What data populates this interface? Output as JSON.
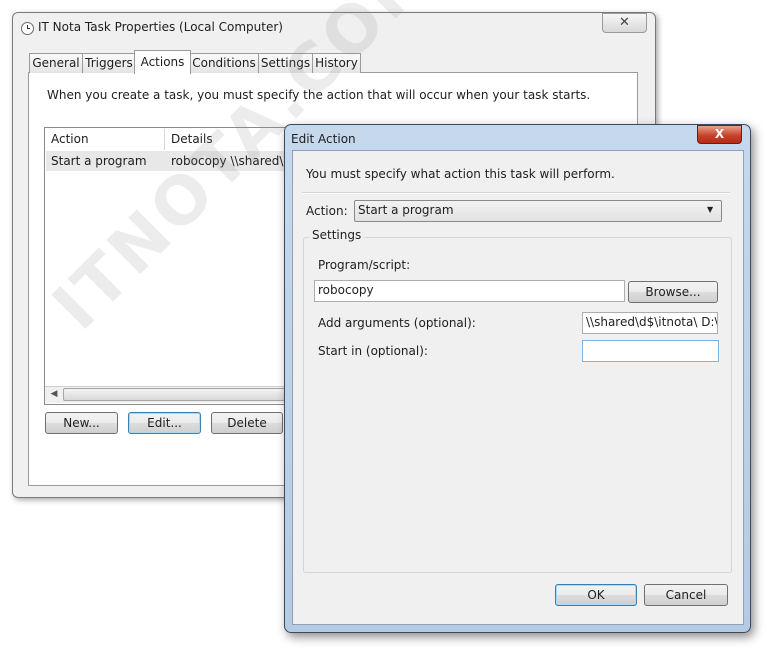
{
  "properties_window": {
    "title": "IT Nota Task Properties (Local Computer)",
    "close_glyph": "✕",
    "tabs": [
      {
        "label": "General"
      },
      {
        "label": "Triggers"
      },
      {
        "label": "Actions",
        "active": true
      },
      {
        "label": "Conditions"
      },
      {
        "label": "Settings"
      },
      {
        "label": "History"
      }
    ],
    "description": "When you create a task, you must specify the action that will occur when your task starts.",
    "list": {
      "columns": [
        "Action",
        "Details"
      ],
      "rows": [
        {
          "action": "Start a program",
          "details": "robocopy \\\\shared\\d$\\itnota\\ D:\\it"
        }
      ]
    },
    "buttons": {
      "new": "New...",
      "edit": "Edit...",
      "delete": "Delete"
    }
  },
  "edit_action_dialog": {
    "title": "Edit Action",
    "close_glyph": "X",
    "description": "You must specify what action this task will perform.",
    "action_label": "Action:",
    "action_value": "Start a program",
    "settings_label": "Settings",
    "program_label": "Program/script:",
    "program_value": "robocopy",
    "browse_label": "Browse...",
    "arguments_label": "Add arguments (optional):",
    "arguments_value": "\\\\shared\\d$\\itnota\\ D:\\it",
    "start_in_label": "Start in (optional):",
    "start_in_value": "",
    "ok_label": "OK",
    "cancel_label": "Cancel"
  },
  "watermark": "ITNOTA.COM",
  "icons": {
    "window_icon": "clock-icon",
    "dropdown": "chevron-down-icon",
    "scroll_left": "arrow-left-icon"
  }
}
